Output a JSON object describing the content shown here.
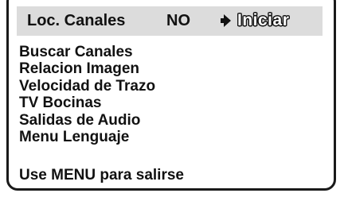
{
  "selected_row": {
    "label": "Loc. Canales",
    "value": "NO",
    "pointer_icon": "play-arrow-icon",
    "action": "Iniciar"
  },
  "menu": {
    "items": [
      {
        "label": "Buscar Canales"
      },
      {
        "label": "Relacion Imagen"
      },
      {
        "label": "Velocidad de Trazo"
      },
      {
        "label": "TV Bocinas"
      },
      {
        "label": "Salidas de Audio"
      },
      {
        "label": "Menu Lenguaje"
      }
    ]
  },
  "footer": {
    "hint": "Use MENU para salirse"
  },
  "colors": {
    "highlight": "#dcdcdc",
    "text": "#111111",
    "frame": "#1a1a1a"
  }
}
